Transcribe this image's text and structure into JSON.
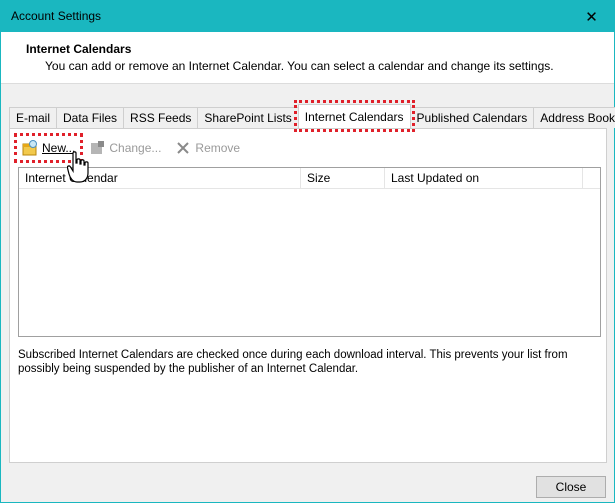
{
  "window": {
    "title": "Account Settings"
  },
  "header": {
    "title": "Internet Calendars",
    "description": "You can add or remove an Internet Calendar. You can select a calendar and change its settings."
  },
  "tabs": [
    {
      "label": "E-mail"
    },
    {
      "label": "Data Files"
    },
    {
      "label": "RSS Feeds"
    },
    {
      "label": "SharePoint Lists"
    },
    {
      "label": "Internet Calendars",
      "active": true
    },
    {
      "label": "Published Calendars"
    },
    {
      "label": "Address Books"
    }
  ],
  "toolbar": {
    "new_label": "New...",
    "change_label": "Change...",
    "remove_label": "Remove"
  },
  "list": {
    "columns": [
      "Internet Calendar",
      "Size",
      "Last Updated on"
    ]
  },
  "info_text": "Subscribed Internet Calendars are checked once during each download interval. This prevents your list from possibly being suspended by the publisher of an Internet Calendar.",
  "footer": {
    "close_label": "Close"
  },
  "colors": {
    "titlebar": "#1ab7c0",
    "highlight": "#e0202a"
  }
}
